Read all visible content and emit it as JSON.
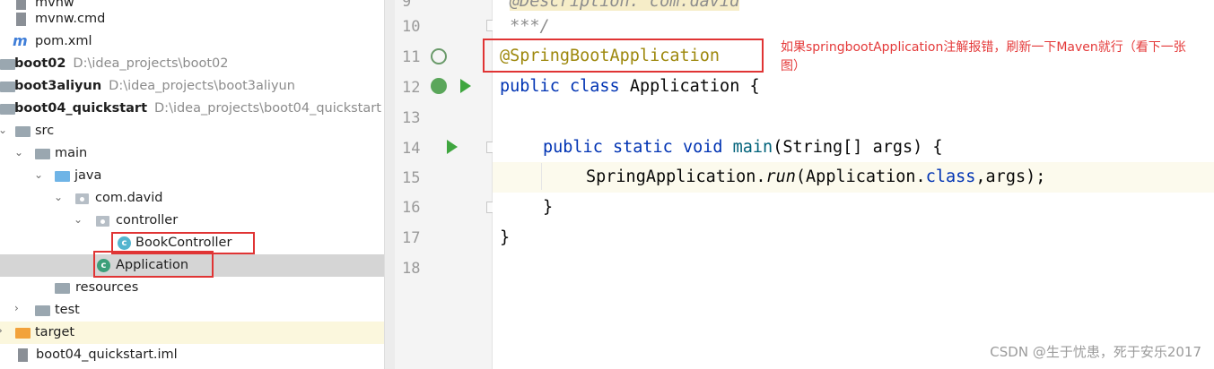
{
  "project_tree": {
    "rows": [
      {
        "label": "mvnw",
        "bold": false
      },
      {
        "label": "mvnw.cmd",
        "bold": false
      },
      {
        "label": "pom.xml",
        "bold": false
      },
      {
        "label": "boot02",
        "path": "D:\\idea_projects\\boot02",
        "bold": true
      },
      {
        "label": "boot3aliyun",
        "path": "D:\\idea_projects\\boot3aliyun",
        "bold": true
      },
      {
        "label": "boot04_quickstart",
        "path": "D:\\idea_projects\\boot04_quickstart",
        "bold": true
      },
      {
        "label": "src"
      },
      {
        "label": "main"
      },
      {
        "label": "java"
      },
      {
        "label": "com.david"
      },
      {
        "label": "controller"
      },
      {
        "label": "BookController"
      },
      {
        "label": "Application"
      },
      {
        "label": "resources"
      },
      {
        "label": "test"
      },
      {
        "label": "target"
      },
      {
        "label": "boot04_quickstart.iml"
      }
    ]
  },
  "editor": {
    "line_numbers": [
      "9",
      "10",
      "11",
      "12",
      "13",
      "14",
      "15",
      "16",
      "17",
      "18"
    ],
    "line9_text": "@Description: com.david",
    "line10_text": " ***/",
    "line11_annotation": "@SpringBootApplication",
    "line12": {
      "kw1": "public",
      "kw2": "class",
      "name": "Application",
      "brace": " {"
    },
    "line14": {
      "kw1": "public",
      "kw2": "static",
      "kw3": "void",
      "method": "main",
      "params": "(String[] args) {"
    },
    "line15": {
      "cls": "SpringApplication.",
      "method": "run",
      "arg1": "(Application.",
      "kw": "class",
      "rest": ",args);"
    },
    "line16_text": "}",
    "line17_text": "}"
  },
  "annotation_note": "如果springbootApplication注解报错，刷新一下Maven就行（看下一张图）",
  "watermark": "CSDN @生于忧患，死于安乐2017",
  "colors": {
    "highlight_red": "#e03434",
    "keyword": "#0033b3",
    "annotation": "#9e880d",
    "method": "#00627a",
    "run_green": "#3fa63f"
  }
}
